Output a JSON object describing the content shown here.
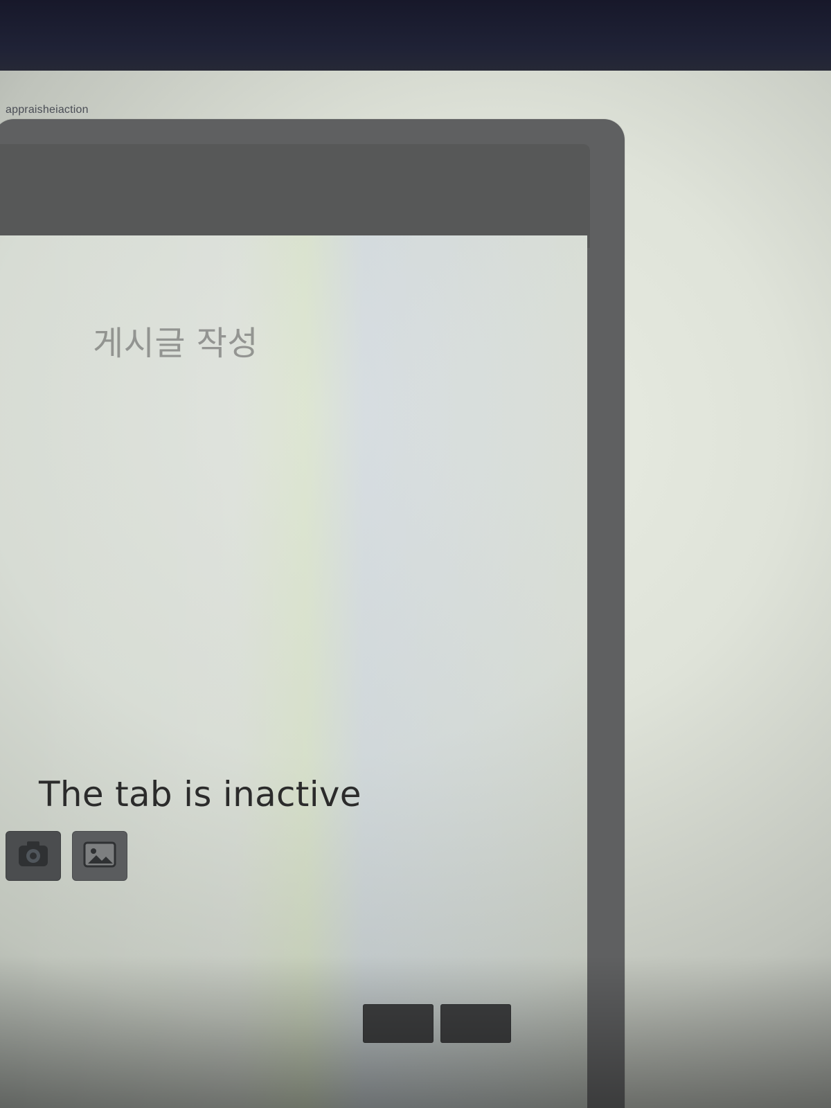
{
  "window": {
    "title": "appraisheiaction"
  },
  "dialog": {
    "title": "게시글 작성",
    "status_text": "The tab is inactive"
  },
  "toolbar": {
    "camera_icon": "camera-icon",
    "photo_icon": "photo-icon"
  },
  "footer": {
    "button_1": "",
    "button_2": ""
  }
}
